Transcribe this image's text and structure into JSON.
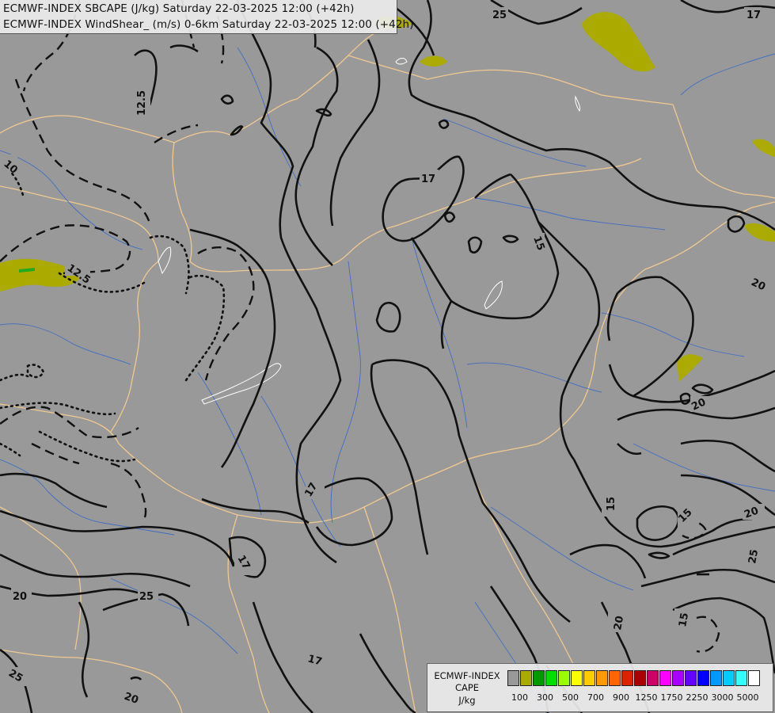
{
  "title": {
    "line1": "ECMWF-INDEX SBCAPE (J/kg) Saturday 22-03-2025 12:00 (+42h)",
    "line2": "ECMWF-INDEX WindShear_ (m/s) 0-6km Saturday 22-03-2025 12:00 (+42h)"
  },
  "legend": {
    "title_line1": "ECMWF-INDEX",
    "title_line2": "CAPE",
    "title_line3": "J/kg",
    "colors": [
      "#999999",
      "#aaaa00",
      "#009900",
      "#00dd00",
      "#99ff00",
      "#ffff00",
      "#ffcc00",
      "#ff9900",
      "#ff6600",
      "#dd2200",
      "#aa0000",
      "#cc0066",
      "#ff00ff",
      "#aa00ff",
      "#6600ff",
      "#0000ff",
      "#0099ff",
      "#00ccff",
      "#33ffff",
      "#ffffff"
    ],
    "tick_labels": [
      "100",
      "300",
      "500",
      "700",
      "900",
      "1250",
      "1750",
      "2250",
      "3000",
      "5000"
    ]
  },
  "contour_labels": {
    "c1": "25",
    "c2": "17",
    "c3": "12.5",
    "c4": "10",
    "c5": "12.5",
    "c6": "17",
    "c7": "15",
    "c8": "20",
    "c9": "20",
    "c10": "17",
    "c11": "15",
    "c12": "15",
    "c13": "20",
    "c14": "25",
    "c15": "20",
    "c16": "15",
    "c17": "17",
    "c18": "20",
    "c19": "25",
    "c20": "17",
    "c21": "25",
    "c22": "20",
    "c23": "20"
  },
  "colors": {
    "background": "#999999",
    "cape_low": "#aaaa00",
    "cape_mid": "#22aa22",
    "border": "#f0c890",
    "river": "#3366cc",
    "contour": "#111111"
  }
}
